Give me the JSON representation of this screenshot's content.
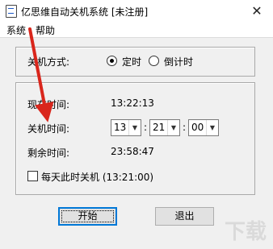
{
  "window": {
    "title": "亿思维自动关机系统 [未注册]"
  },
  "menu": {
    "items": [
      "系统",
      "帮助"
    ]
  },
  "mode": {
    "label": "关机方式:",
    "option_scheduled": "定时",
    "option_countdown": "倒计时",
    "selected": "定时"
  },
  "times": {
    "current_label": "现在时间:",
    "current_value": "13:22:13",
    "shutdown_label": "关机时间:",
    "hour": "13",
    "minute": "21",
    "second": "00",
    "separator": ":",
    "remaining_label": "剩余时间:",
    "remaining_value": "23:58:47"
  },
  "daily": {
    "label": "每天此时关机 (13:21:00)",
    "checked": false
  },
  "buttons": {
    "start": "开始",
    "exit": "退出"
  },
  "icons": {
    "close": "close-icon",
    "app": "app-icon",
    "dropdown": "chevron-down-icon"
  },
  "annotation": {
    "arrow_color": "#d9261c"
  },
  "watermark": {
    "text": "下载"
  }
}
